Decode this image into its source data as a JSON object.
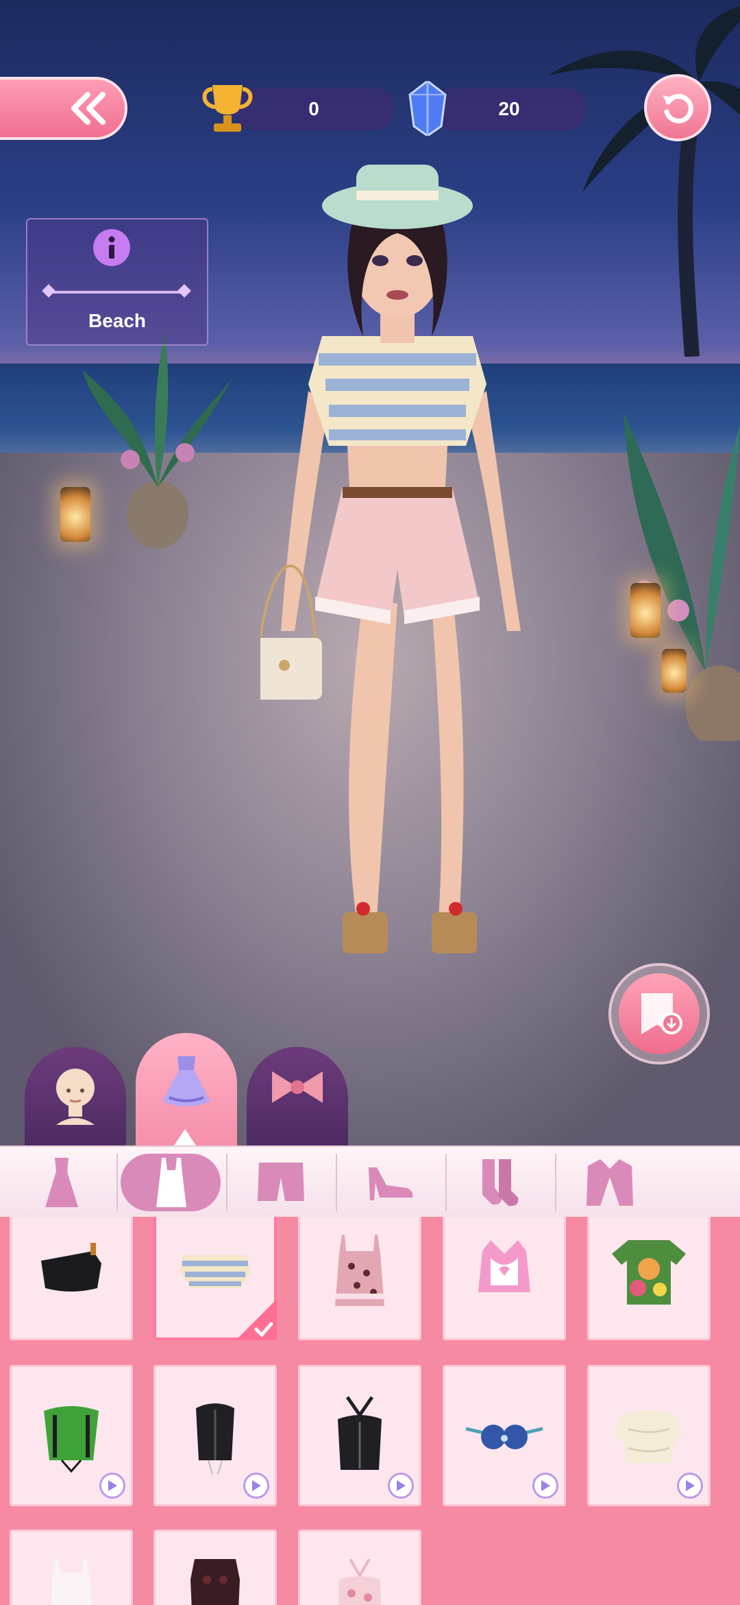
{
  "hud": {
    "trophy_count": "0",
    "gem_count": "20"
  },
  "theme": {
    "label": "Beach"
  },
  "categories": [
    {
      "name": "body",
      "active": false
    },
    {
      "name": "clothes",
      "active": true
    },
    {
      "name": "accessories",
      "active": false
    }
  ],
  "subcategories": [
    "dress-icon",
    "top-icon",
    "shorts-icon",
    "heel-icon",
    "socks-icon",
    "jacket-icon"
  ],
  "colors": {
    "accent": "#f07693",
    "panel": "#f78aa3",
    "card": "#fde6ee"
  },
  "items": [
    {
      "name": "black-one-shoulder-top",
      "selected": false,
      "video": false
    },
    {
      "name": "striped-crop-top",
      "selected": true,
      "video": false
    },
    {
      "name": "leopard-camisole",
      "selected": false,
      "video": false
    },
    {
      "name": "pink-halter-top",
      "selected": false,
      "video": false
    },
    {
      "name": "green-floral-tee",
      "selected": false,
      "video": false
    },
    {
      "name": "green-corset",
      "selected": false,
      "video": true
    },
    {
      "name": "black-corset",
      "selected": false,
      "video": true
    },
    {
      "name": "black-halter-corset",
      "selected": false,
      "video": true
    },
    {
      "name": "blue-shell-bra",
      "selected": false,
      "video": true
    },
    {
      "name": "cream-lace-blouse",
      "selected": false,
      "video": true
    },
    {
      "name": "white-cami",
      "selected": false,
      "video": false
    },
    {
      "name": "dark-lace-top",
      "selected": false,
      "video": false
    },
    {
      "name": "floral-halter-top",
      "selected": false,
      "video": false
    }
  ]
}
